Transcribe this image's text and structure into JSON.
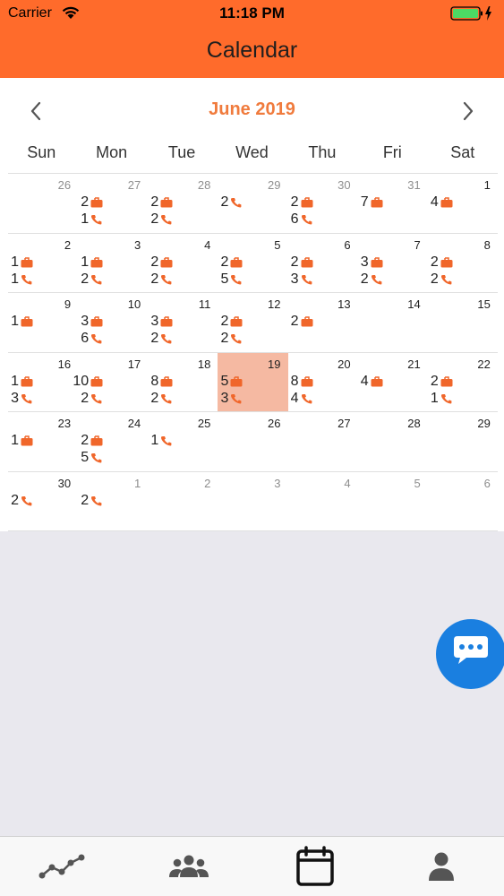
{
  "status": {
    "carrier": "Carrier",
    "time": "11:18 PM"
  },
  "nav": {
    "title": "Calendar"
  },
  "calendar": {
    "month": "June 2019",
    "weekdays": [
      "Sun",
      "Mon",
      "Tue",
      "Wed",
      "Thu",
      "Fri",
      "Sat"
    ],
    "weeks": [
      [
        {
          "day": "26",
          "other": true
        },
        {
          "day": "27",
          "other": true,
          "briefcase": "2",
          "phone": "1"
        },
        {
          "day": "28",
          "other": true,
          "briefcase": "2",
          "phone": "2"
        },
        {
          "day": "29",
          "other": true,
          "phone": "2"
        },
        {
          "day": "30",
          "other": true,
          "briefcase": "2",
          "phone": "6"
        },
        {
          "day": "31",
          "other": true,
          "briefcase": "7"
        },
        {
          "day": "1",
          "briefcase": "4"
        }
      ],
      [
        {
          "day": "2",
          "briefcase": "1",
          "phone": "1"
        },
        {
          "day": "3",
          "briefcase": "1",
          "phone": "2"
        },
        {
          "day": "4",
          "briefcase": "2",
          "phone": "2"
        },
        {
          "day": "5",
          "briefcase": "2",
          "phone": "5"
        },
        {
          "day": "6",
          "briefcase": "2",
          "phone": "3"
        },
        {
          "day": "7",
          "briefcase": "3",
          "phone": "2"
        },
        {
          "day": "8",
          "briefcase": "2",
          "phone": "2"
        }
      ],
      [
        {
          "day": "9",
          "briefcase": "1"
        },
        {
          "day": "10",
          "briefcase": "3",
          "phone": "6"
        },
        {
          "day": "11",
          "briefcase": "3",
          "phone": "2"
        },
        {
          "day": "12",
          "briefcase": "2",
          "phone": "2"
        },
        {
          "day": "13",
          "briefcase": "2"
        },
        {
          "day": "14"
        },
        {
          "day": "15"
        }
      ],
      [
        {
          "day": "16",
          "briefcase": "1",
          "phone": "3"
        },
        {
          "day": "17",
          "briefcase": "10",
          "phone": "2"
        },
        {
          "day": "18",
          "briefcase": "8",
          "phone": "2"
        },
        {
          "day": "19",
          "briefcase": "5",
          "phone": "3",
          "selected": true
        },
        {
          "day": "20",
          "briefcase": "8",
          "phone": "4"
        },
        {
          "day": "21",
          "briefcase": "4"
        },
        {
          "day": "22",
          "briefcase": "2",
          "phone": "1"
        }
      ],
      [
        {
          "day": "23",
          "briefcase": "1"
        },
        {
          "day": "24",
          "briefcase": "2",
          "phone": "5"
        },
        {
          "day": "25",
          "phone": "1"
        },
        {
          "day": "26"
        },
        {
          "day": "27"
        },
        {
          "day": "28"
        },
        {
          "day": "29"
        }
      ],
      [
        {
          "day": "30",
          "phone": "2"
        },
        {
          "day": "1",
          "other": true,
          "phone": "2"
        },
        {
          "day": "2",
          "other": true
        },
        {
          "day": "3",
          "other": true
        },
        {
          "day": "4",
          "other": true
        },
        {
          "day": "5",
          "other": true
        },
        {
          "day": "6",
          "other": true
        }
      ]
    ]
  },
  "colors": {
    "accent": "#ff6b2b",
    "icon": "#f0662a",
    "month": "#f07b3d",
    "selected": "#f5b9a2",
    "fab": "#1a7fe0"
  },
  "tabs": [
    "trend-icon",
    "group-icon",
    "calendar-icon",
    "profile-icon"
  ]
}
